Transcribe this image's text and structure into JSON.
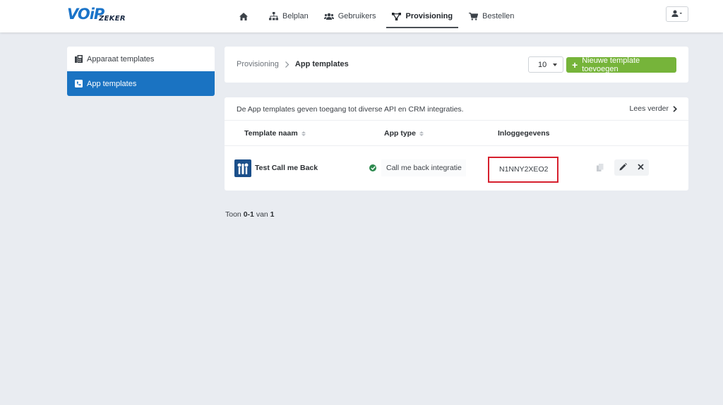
{
  "logo": {
    "main": "VOiP",
    "sub": "ZEKER"
  },
  "nav": {
    "items": [
      {
        "label": "",
        "icon": "home-icon"
      },
      {
        "label": "Belplan",
        "icon": "sitemap-icon"
      },
      {
        "label": "Gebruikers",
        "icon": "users-icon"
      },
      {
        "label": "Provisioning",
        "icon": "network-icon",
        "active": true
      },
      {
        "label": "Bestellen",
        "icon": "cart-icon"
      }
    ]
  },
  "user_menu": {
    "icon": "user-icon"
  },
  "sidebar": {
    "items": [
      {
        "label": "Apparaat templates",
        "icon": "fax-icon"
      },
      {
        "label": "App templates",
        "icon": "phone-square-icon",
        "active": true
      }
    ]
  },
  "breadcrumb": {
    "parent": "Provisioning",
    "current": "App templates"
  },
  "toolbar": {
    "per_page": "10",
    "add_label": "Nieuwe template toevoegen"
  },
  "info": {
    "text": "De App templates geven toegang tot diverse API en CRM integraties.",
    "more": "Lees verder"
  },
  "table": {
    "headers": {
      "name": "Template naam",
      "type": "App type",
      "login": "Inloggegevens"
    },
    "rows": [
      {
        "name": "Test Call me Back",
        "type": "Call me back integratie",
        "login": "N1NNY2XEO2",
        "status": "active"
      }
    ]
  },
  "pagination": {
    "prefix": "Toon",
    "range": "0-1",
    "mid": "van",
    "total": "1"
  },
  "colors": {
    "primary": "#1a73c2",
    "success": "#76b43a",
    "highlight": "#d6202e"
  }
}
